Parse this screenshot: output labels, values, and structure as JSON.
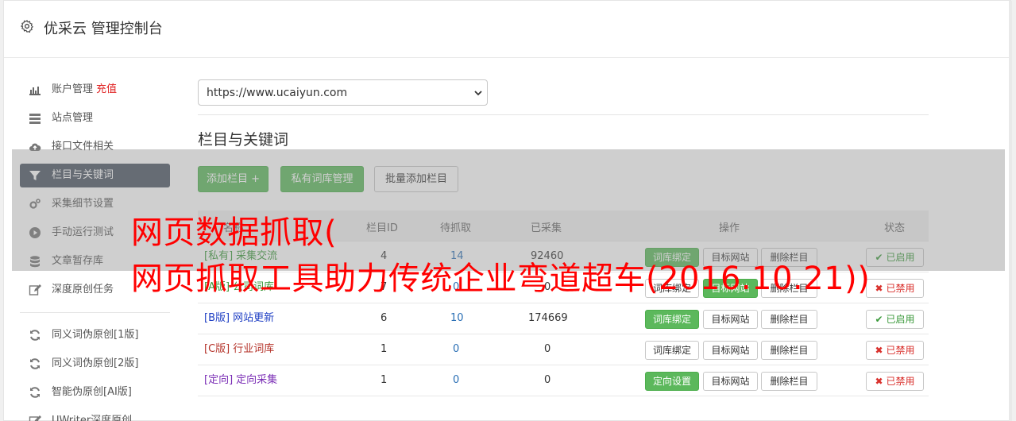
{
  "header": {
    "title": "优采云 管理控制台"
  },
  "sidebar": {
    "items": [
      {
        "label": "账户管理",
        "extra": "充值",
        "icon": "bar-chart-icon"
      },
      {
        "label": "站点管理",
        "icon": "server-icon"
      },
      {
        "label": "接口文件相关",
        "icon": "cloud-upload-icon"
      },
      {
        "label": "栏目与关键词",
        "icon": "filter-icon",
        "active": true
      },
      {
        "label": "采集细节设置",
        "icon": "cogs-icon"
      },
      {
        "label": "手动运行测试",
        "icon": "play-icon"
      },
      {
        "label": "文章暂存库",
        "icon": "database-icon"
      },
      {
        "label": "深度原创任务",
        "icon": "edit-icon"
      },
      {
        "label": "同义词伪原创[1版]",
        "icon": "refresh-icon"
      },
      {
        "label": "同义词伪原创[2版]",
        "icon": "refresh-icon"
      },
      {
        "label": "智能伪原创[AI版]",
        "icon": "refresh-icon"
      },
      {
        "label": "UWriter深度原创",
        "icon": "edit-icon"
      }
    ]
  },
  "main": {
    "site_select": {
      "value": "https://www.ucaiyun.com"
    },
    "section_title": "栏目与关键词",
    "buttons": {
      "add_column": "添加栏目 +",
      "private_lib": "私有词库管理",
      "batch_add": "批量添加栏目"
    },
    "table": {
      "headers": [
        "名称",
        "栏目ID",
        "待抓取",
        "已采集",
        "操作",
        "状态"
      ],
      "rows": [
        {
          "tag": "[私有]",
          "name": "采集交流",
          "id": "4",
          "pending": "14",
          "collected": "92460",
          "op1": "词库绑定",
          "op2": "目标网站",
          "op3": "删除栏目",
          "status": "已启用",
          "tag_color": "#3c9a3c",
          "status_on": true,
          "op1_green": true
        },
        {
          "tag": "[A版]",
          "name": "公司词库",
          "id": "7",
          "pending": "0",
          "collected": "0",
          "op1": "词库绑定",
          "op2": "目标网站",
          "op3": "删除栏目",
          "status": "已禁用",
          "tag_color": "#3c9a3c",
          "status_on": false,
          "op1_green": false,
          "op2_green": true
        },
        {
          "tag": "[B版]",
          "name": "网站更新",
          "id": "6",
          "pending": "10",
          "collected": "174669",
          "op1": "词库绑定",
          "op2": "目标网站",
          "op3": "删除栏目",
          "status": "已启用",
          "tag_color": "#1f3fc4",
          "status_on": true,
          "op1_green": true
        },
        {
          "tag": "[C版]",
          "name": "行业词库",
          "id": "1",
          "pending": "0",
          "collected": "0",
          "op1": "词库绑定",
          "op2": "目标网站",
          "op3": "删除栏目",
          "status": "已禁用",
          "tag_color": "#b5332a",
          "status_on": false,
          "op1_green": false
        },
        {
          "tag": "[定向]",
          "name": "定向采集",
          "id": "1",
          "pending": "0",
          "collected": "0",
          "op1": "定向设置",
          "op2": "目标网站",
          "op3": "删除栏目",
          "status": "已禁用",
          "tag_color": "#7a2db5",
          "status_on": false,
          "op1_green": true
        }
      ]
    }
  },
  "overlay": {
    "line1": "网页数据抓取(",
    "line2": "网页抓取工具助力传统企业弯道超车(2016.10.21))"
  },
  "colors": {
    "green": "#5cb85c",
    "active_nav": "#4b5563",
    "danger": "#d9302c",
    "link": "#2a6fb5",
    "overlay_text": "#ff0000"
  }
}
